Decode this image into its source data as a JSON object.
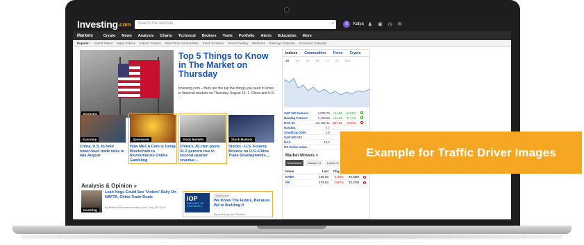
{
  "header": {
    "logo": "Investing",
    "logo_suffix": ".com",
    "search_placeholder": "Search the website...",
    "user_initial": "K",
    "user_name": "Katya"
  },
  "nav": {
    "items": [
      "Markets",
      "Crypto",
      "News",
      "Analysis",
      "Charts",
      "Technical",
      "Brokers",
      "Tools",
      "Portfolio",
      "Alerts",
      "Education",
      "More"
    ]
  },
  "popular": {
    "label": "Popular:",
    "items": [
      "United States",
      "Major Indices",
      "Indices Futures",
      "Real Time Commodities",
      "Stock Screener",
      "Social Trading",
      "Webinars",
      "Earnings Calendar",
      "Economic Calendar"
    ]
  },
  "hero": {
    "tag": "Economy",
    "title": "Top 5 Things to Know in The Market on Thursday",
    "description": "Investing.com – Here are the top five things you need to know in financial markets on Thursday, August 16: 1. China and U.S. ..."
  },
  "thumbs": [
    {
      "tag": "Economy",
      "title": "China, U.S. to hold lower-level trade talks in late August"
    },
    {
      "tag": "Sponsored",
      "title": "How MECA Coin is Using Blockchain to Revolutionize Online Gambling"
    },
    {
      "tag": "Stock Markets",
      "title": "China's JD.com posts 31.2 percent rise in second-quarter revenue,..."
    },
    {
      "tag": "Stock Markets",
      "title": "Stocks - U.S. Futures Bounce on U.S.-China Trade Developments,..."
    }
  ],
  "analysis": {
    "section_title": "Analysis & Opinion »",
    "article_title": "Lean Hogs Could See 'Violent' Rally On NAFTA, China Trade Deals",
    "article_meta": "By Barani Krishnan/Investing.com · Aug 15, 2018",
    "image_tag": "Investing",
    "sponsored_badge": "Sponsored",
    "sponsored_title": "We Know The Future, Because We're Building It",
    "sponsored_meta": "By Investing.com Studios",
    "sponsored_img_text": "IOP",
    "sponsored_img_sub": "AVAILABLE ON EXCHANGES"
  },
  "right_panel": {
    "tabs": [
      "Indices",
      "Commodities",
      "Forex",
      "Crypto"
    ],
    "periods": [
      "1D",
      "1W",
      "1M",
      "6M",
      "1Y",
      "5Y",
      "Max"
    ],
    "quotes": [
      {
        "name": "S&P 500 Futures",
        "last": "2,830.75",
        "chg": "+14.00",
        "pct": "+0.51%",
        "dir": "pos"
      },
      {
        "name": "Nasdaq Futures",
        "last": "7,428.25",
        "chg": "+54.25",
        "pct": "+0.74%",
        "dir": "pos"
      },
      {
        "name": "Dow 30",
        "last": "25,162.41",
        "chg": "-137.51",
        "pct": "-0.54%",
        "dir": "neg"
      },
      {
        "name": "Nasdaq",
        "last": "7,7",
        "chg": "",
        "pct": "",
        "dir": "neg"
      },
      {
        "name": "SmallCap 2000",
        "last": "1,6",
        "chg": "",
        "pct": "",
        "dir": "pos"
      },
      {
        "name": "S&P 500 VIX",
        "last": "",
        "chg": "",
        "pct": "",
        "dir": "neg"
      },
      {
        "name": "DAX",
        "last": "12,2",
        "chg": "",
        "pct": "",
        "dir": "neg"
      },
      {
        "name": "US Dollar Index",
        "last": "",
        "chg": "",
        "pct": "",
        "dir": "pos"
      }
    ],
    "movers": {
      "title": "Market Movers »",
      "tabs": [
        "Most Active",
        "Gainers %",
        "Losers %"
      ],
      "headers": [
        "Name",
        "Last",
        "Chg. %",
        "Vol."
      ],
      "rows": [
        {
          "name": "BABA",
          "last": "165.00",
          "chg": "-1.93%",
          "vol": "40.85M"
        },
        {
          "name": "FB",
          "last": "179.53",
          "chg": "-0.87%",
          "vol": "32.47M"
        }
      ]
    }
  },
  "callout": {
    "text": "Example for Traffic Driver images",
    "color": "#f5a623"
  }
}
